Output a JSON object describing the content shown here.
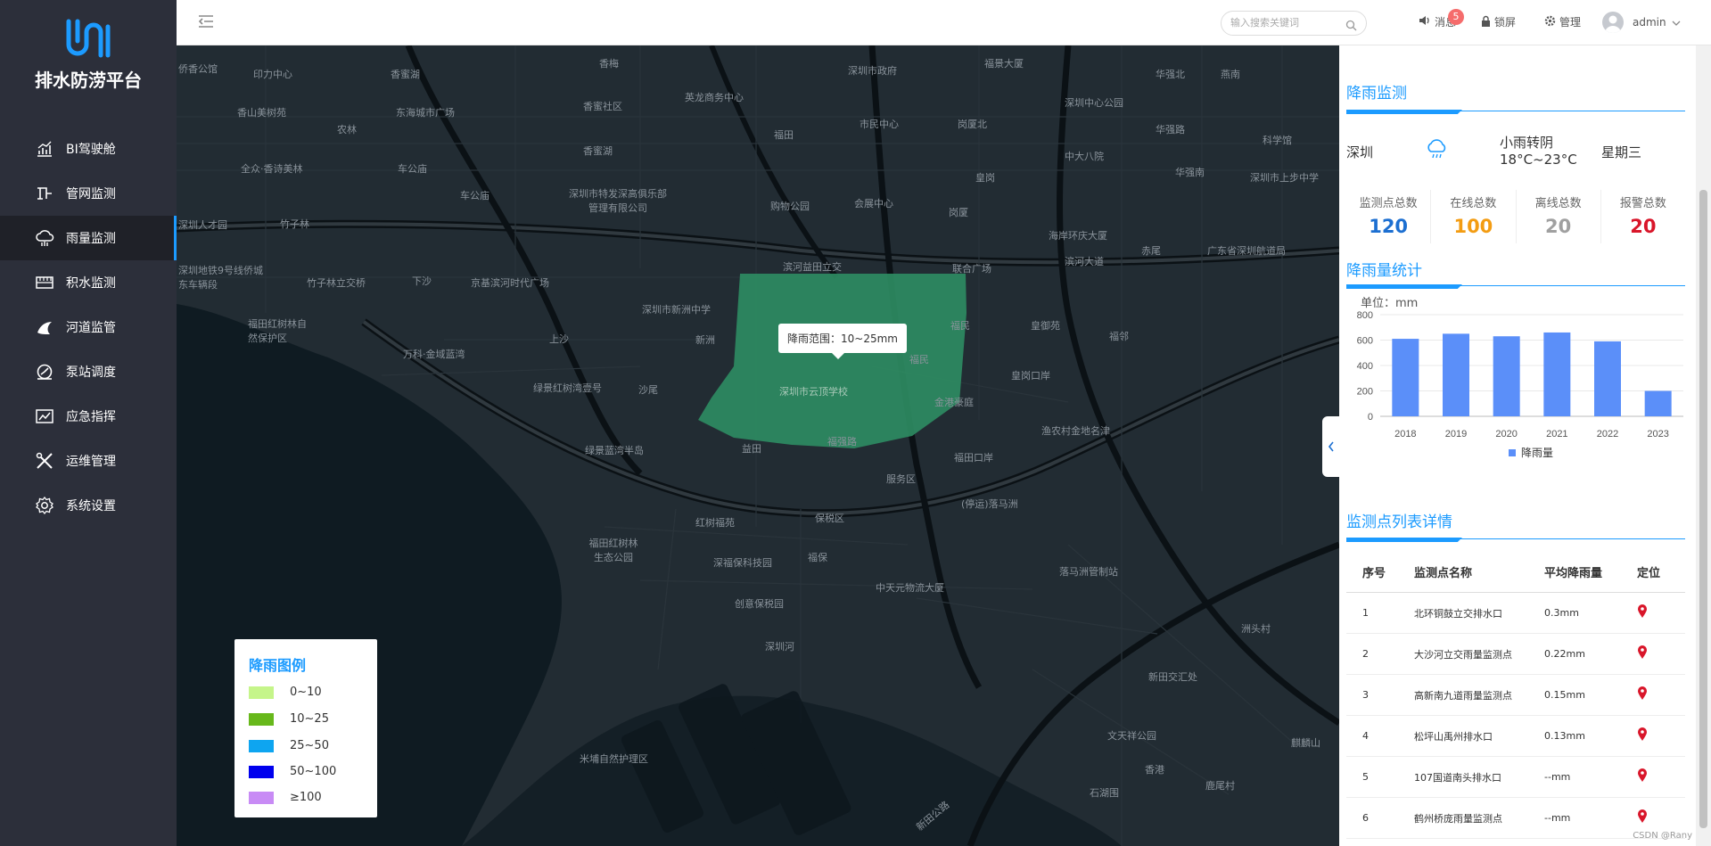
{
  "app": {
    "title": "排水防涝平台"
  },
  "sidebar": {
    "items": [
      {
        "label": "BI驾驶舱",
        "icon": "chart-icon"
      },
      {
        "label": "管网监测",
        "icon": "pipe-icon"
      },
      {
        "label": "雨量监测",
        "icon": "cloud-rain-icon",
        "active": true
      },
      {
        "label": "积水监测",
        "icon": "waterlogging-icon"
      },
      {
        "label": "河道监管",
        "icon": "river-icon"
      },
      {
        "label": "泵站调度",
        "icon": "pump-icon"
      },
      {
        "label": "应急指挥",
        "icon": "emergency-icon"
      },
      {
        "label": "运维管理",
        "icon": "tools-icon"
      },
      {
        "label": "系统设置",
        "icon": "gear-icon"
      }
    ]
  },
  "header": {
    "search_placeholder": "输入搜索关键词",
    "message_label": "消息",
    "message_count": "5",
    "lock_label": "锁屏",
    "admin_label": "管理",
    "user_name": "admin"
  },
  "map": {
    "tooltip": "降雨范围：10~25mm",
    "labels": [
      "侨香公馆",
      "印力中心",
      "香蜜湖",
      "香梅",
      "深圳市政府",
      "福景大厦",
      "华强北",
      "燕南",
      "香山美树苑",
      "东海城市广场",
      "香蜜社区",
      "英龙商务中心",
      "深圳中心公园",
      "农林",
      "福田",
      "市民中心",
      "岗厦北",
      "华强路",
      "科学馆",
      "香蜜湖",
      "中大八院",
      "全众·香诗美林",
      "车公庙",
      "皇岗",
      "华强南",
      "深圳市上步中学",
      "深圳人才园",
      "竹子林",
      "车公庙",
      "深圳市特发深高俱乐部管理有限公司",
      "购物公园",
      "会展中心",
      "岗厦",
      "海岸环庆大厦",
      "赤尾",
      "广东省深圳航道局",
      "滨河益田立交",
      "联合广场",
      "滨河大道",
      "深圳地铁9号线侨城东车辆段",
      "竹子林立交桥",
      "下沙",
      "京基滨河时代广场",
      "深圳市新洲中学",
      "福民",
      "皇御苑",
      "福田红树林自然保护区",
      "上沙",
      "新洲",
      "福邻",
      "万科·金域蓝湾",
      "福民",
      "绿景红树湾壹号",
      "沙尾",
      "深圳市云顶学校",
      "皇岗口岸",
      "金港豪庭",
      "益田",
      "福强路",
      "渔农村金地名津",
      "绿景蓝湾半岛",
      "福田口岸",
      "服务区",
      "(停运)落马洲",
      "红树福苑",
      "保税区",
      "福田红树林生态公园",
      "深福保科技园",
      "福保",
      "落马洲管制站",
      "创意保税园",
      "中天元物流大厦",
      "洲头村",
      "新田交汇处",
      "深圳河",
      "文天祥公园",
      "米埔自然护理区",
      "麒麟山",
      "鹿尾村",
      "石湖围",
      "新田公路",
      "香港"
    ]
  },
  "legend": {
    "title": "降雨图例",
    "items": [
      {
        "label": "0~10",
        "color": "#c5f58a"
      },
      {
        "label": "10~25",
        "color": "#67b81b"
      },
      {
        "label": "25~50",
        "color": "#0ea5f0"
      },
      {
        "label": "50~100",
        "color": "#0000ee"
      },
      {
        "label": "≥100",
        "color": "#c88bf5"
      }
    ]
  },
  "rain_monitor": {
    "title": "降雨监测",
    "city": "深圳",
    "weather": "小雨转阴",
    "temp": "18°C~23°C",
    "weekday": "星期三",
    "stats": [
      {
        "label": "监测点总数",
        "value": "120",
        "color": "#1c6fd1"
      },
      {
        "label": "在线总数",
        "value": "100",
        "color": "#f39c12"
      },
      {
        "label": "离线总数",
        "value": "20",
        "color": "#a0a0a0"
      },
      {
        "label": "报警总数",
        "value": "20",
        "color": "#d9162a"
      }
    ]
  },
  "rain_stats": {
    "title": "降雨量统计",
    "unit": "单位：mm"
  },
  "chart_data": {
    "type": "bar",
    "categories": [
      "2018",
      "2019",
      "2020",
      "2021",
      "2022",
      "2023"
    ],
    "series": [
      {
        "name": "降雨量",
        "values": [
          610,
          650,
          630,
          660,
          590,
          200
        ]
      }
    ],
    "ylim": [
      0,
      800
    ],
    "yticks": [
      "0",
      "200",
      "400",
      "600",
      "800"
    ],
    "color": "#5b8ff9",
    "grid": true,
    "legend": "bottom"
  },
  "station_list": {
    "title": "监测点列表详情",
    "headers": [
      "序号",
      "监测点名称",
      "平均降雨量",
      "定位"
    ],
    "rows": [
      [
        "1",
        "北环铜鼓立交排水口",
        "0.3mm"
      ],
      [
        "2",
        "大沙河立交雨量监测点",
        "0.22mm"
      ],
      [
        "3",
        "高新南九道雨量监测点",
        "0.15mm"
      ],
      [
        "4",
        "松坪山禹州排水口",
        "0.13mm"
      ],
      [
        "5",
        "107国道南头排水口",
        "--mm"
      ],
      [
        "6",
        "鹤州桥庞雨量监测点",
        "--mm"
      ]
    ]
  },
  "watermark": "CSDN @Rany"
}
